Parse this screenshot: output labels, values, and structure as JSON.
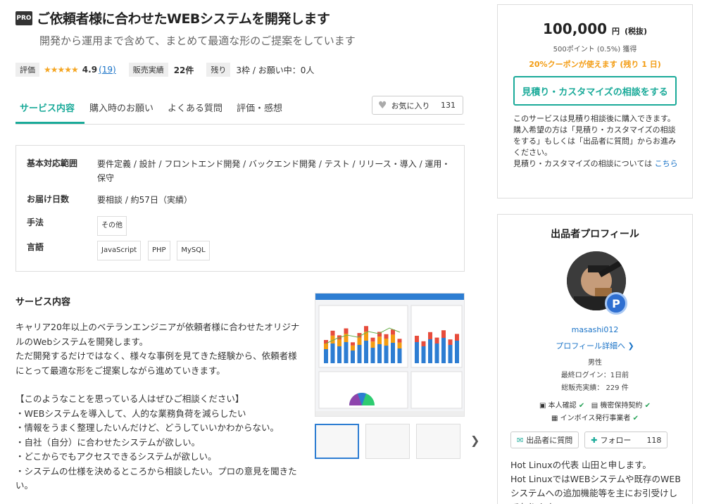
{
  "service": {
    "pro_badge": "PRO",
    "title": "ご依頼者様に合わせたWEBシステムを開発します",
    "subtitle": "開発から運用まで含めて、まとめて最適な形のご提案をしています"
  },
  "stats": {
    "rating_label": "評価",
    "stars": "★★★★★",
    "rating": "4.9",
    "rating_count": "(19)",
    "sales_label": "販売実績",
    "sales_value": "22件",
    "remaining_label": "残り",
    "remaining_value": "3枠 / お願い中：0人"
  },
  "tabs": [
    {
      "label": "サービス内容"
    },
    {
      "label": "購入時のお願い"
    },
    {
      "label": "よくある質問"
    },
    {
      "label": "評価・感想"
    }
  ],
  "favorite": {
    "label": "お気に入り",
    "count": "131"
  },
  "specs": {
    "scope_label": "基本対応範囲",
    "scope_value": "要件定義 / 設計 / フロントエンド開発 / バックエンド開発 / テスト / リリース・導入 / 運用・保守",
    "delivery_label": "お届け日数",
    "delivery_value": "要相談 / 約57日（実績）",
    "method_label": "手法",
    "method_chips": [
      "その他"
    ],
    "lang_label": "言語",
    "lang_chips": [
      "JavaScript",
      "PHP",
      "MySQL"
    ]
  },
  "description": {
    "heading": "サービス内容",
    "para1": "キャリア20年以上のベテランエンジニアが依頼者様に合わせたオリジナルのWebシステムを開発します。\nただ開発するだけではなく、様々な事例を見てきた経験から、依頼者様にとって最適な形をご提案しながら進めていきます。",
    "para2": "【このようなことを思っている人はぜひご相談ください】\n・WEBシステムを導入して、人的な業務負荷を減らしたい\n・情報をうまく整理したいんだけど、どうしていいかわからない。\n・自社（自分）に合わせたシステムが欲しい。\n・どこからでもアクセスできるシステムが欲しい。\n・システムの仕様を決めるところから相談したい。プロの意見を聞きたい。"
  },
  "pricing": {
    "price": "100,000",
    "price_unit": "円",
    "tax_note": "(税抜)",
    "points": "500ポイント (0.5%) 獲得",
    "coupon": "20%クーポンが使えます (残り 1 日)",
    "consult_button": "見積り・カスタマイズの相談をする",
    "note_text": "このサービスは見積り相談後に購入できます。購入希望の方は「見積り・カスタマイズの相談をする」もしくは「出品者に質問」からお進みください。\n見積り・カスタマイズの相談については ",
    "note_link": "こちら"
  },
  "profile": {
    "heading": "出品者プロフィール",
    "badge": "P",
    "username": "masashi012",
    "detail_link": "プロフィール詳細へ ❯",
    "gender": "男性",
    "last_login": "最終ログイン：1日前",
    "total_sales": "総販売実績： 229 件",
    "verif1": "本人確認",
    "verif2": "機密保持契約",
    "verif3": "インボイス発行事業者",
    "ask_button": "出品者に質問",
    "follow_button": "フォロー",
    "follow_count": "118",
    "intro": "Hot Linuxの代表 山田と申します。\nHot LinuxではWEBシステムや既存のWEBシステムへの追加機能等を主にお引受けしております。"
  },
  "colors": {
    "accent": "#1aaa99",
    "link": "#1a73c7",
    "coupon": "#f39c12",
    "star": "#f5a623"
  }
}
